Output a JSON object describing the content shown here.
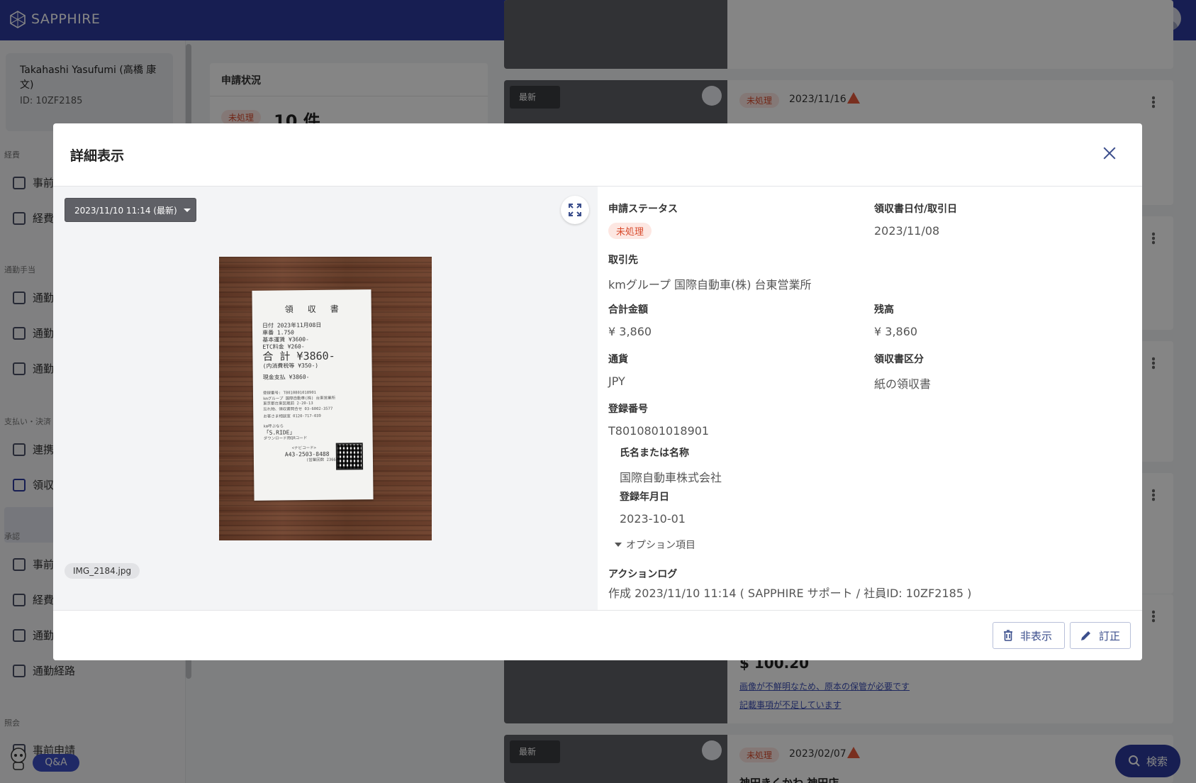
{
  "app": {
    "name": "SAPPHIRE"
  },
  "sidebar": {
    "user_name": "Takahashi Yasufumi (高橋 康文)",
    "user_id": "ID: 10ZF2185",
    "sections": [
      "経費",
      "通勤手当",
      "支払い・決済",
      "承認",
      "照会"
    ],
    "items": [
      {
        "label": "事前"
      },
      {
        "label": "経費"
      },
      {
        "label": "通勤"
      },
      {
        "label": "通勤"
      },
      {
        "label": "通勤"
      },
      {
        "label": "連携"
      },
      {
        "label": "領収"
      },
      {
        "label": "事前"
      },
      {
        "label": "経費"
      },
      {
        "label": "通勤"
      },
      {
        "label": "通勤経路"
      },
      {
        "label": "事前申請"
      }
    ],
    "qa_label": "Q&A"
  },
  "background": {
    "status_card": {
      "title": "申請状況",
      "pill": "未処理",
      "count": "10 件"
    },
    "cards": [
      {
        "latest": "最新",
        "status": "未処理",
        "date": "2023/11/16"
      },
      {
        "amount": "$ 100.20",
        "notes": [
          "画像が不鮮明なため、原本の保管が必要です",
          "記載事項が不足しています"
        ]
      },
      {
        "latest": "最新",
        "status": "未処理",
        "date": "2023/02/07",
        "vendor": "神田きくかわ 神田店"
      }
    ],
    "search_label": "検索"
  },
  "modal": {
    "title": "詳細表示",
    "version_select": "2023/11/10 11:14 (最新)",
    "file_name": "IMG_2184.jpg",
    "receipt_image": {
      "title": "領収書",
      "date_line": "日付 2023年11月08日",
      "car_line": "車番   1.750",
      "base_fare": "基本運賃          ¥3600-",
      "etc": "ETC料金           ¥260-",
      "total": "合 計  ¥3860-",
      "tax": "(内消費税等        ¥350-)",
      "cash": "現金支払          ¥3860-",
      "reg": "登録番号: T8010801018901",
      "company": "kmグループ 国際自動車(株) 台東営業所",
      "address": "東京都台東区蔵前 2-20-13",
      "lost": "忘れ物、領収書問合せ 03-6002-3577",
      "support": "お客さま相談室 0120-717-039",
      "app": "km呼ぶなら",
      "sride": "「S.RIDE」",
      "download": "ダウンロード用QRコード",
      "navi": "<ナビコード>",
      "navi_code": "A43-2503-8488",
      "trips": "(営業回数 2366)"
    },
    "fields": {
      "status_label": "申請ステータス",
      "status_value": "未処理",
      "date_label": "領収書日付/取引日",
      "date_value": "2023/11/08",
      "vendor_label": "取引先",
      "vendor_value": "kmグループ 国際自動車(株) 台東営業所",
      "total_label": "合計金額",
      "total_value": "¥ 3,860",
      "balance_label": "残高",
      "balance_value": "¥ 3,860",
      "currency_label": "通貨",
      "currency_value": "JPY",
      "receipt_type_label": "領収書区分",
      "receipt_type_value": "紙の領収書",
      "reg_no_label": "登録番号",
      "reg_no_value": "T8010801018901",
      "name_label": "氏名または名称",
      "name_value": "国際自動車株式会社",
      "reg_date_label": "登録年月日",
      "reg_date_value": "2023-10-01",
      "options_label": "オプション項目",
      "log_label": "アクションログ",
      "log_value": "作成 2023/11/10 11:14 ( SAPPHIRE サポート / 社員ID: 10ZF2185 )"
    },
    "buttons": {
      "hide": "非表示",
      "correct": "訂正"
    }
  },
  "colors": {
    "brand": "#2c3a9e",
    "status_pill_bg": "#fde7e2",
    "status_pill_text": "#d84a2c",
    "action": "#3b4e8c"
  }
}
